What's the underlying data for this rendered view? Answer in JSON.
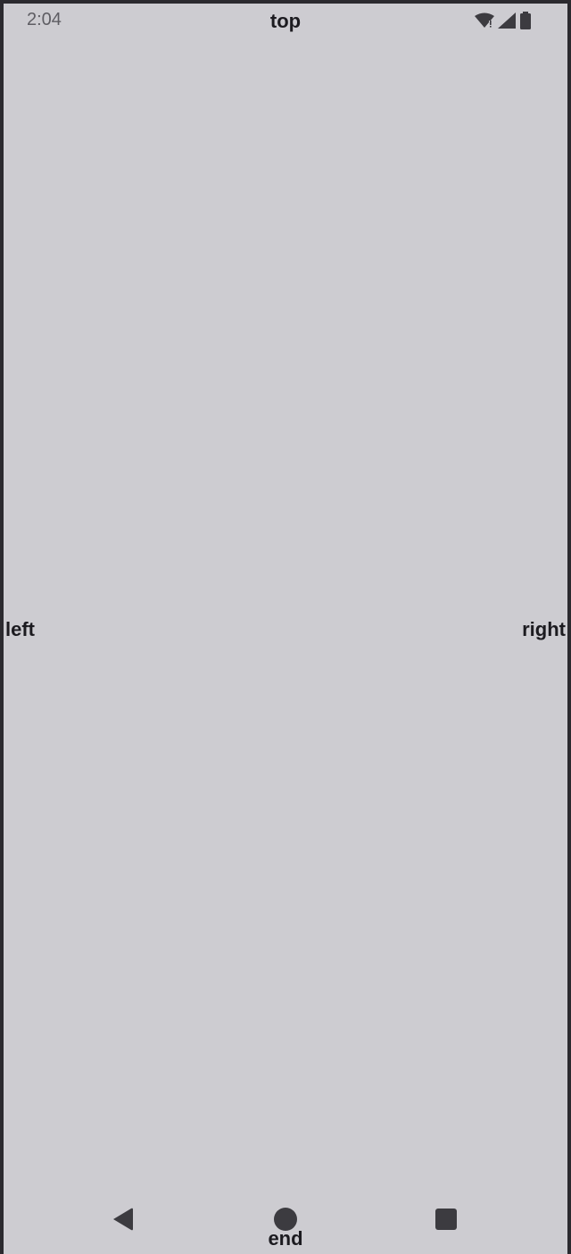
{
  "status_bar": {
    "time": "2:04",
    "icons": [
      "wifi-icon",
      "signal-icon",
      "battery-icon"
    ]
  },
  "labels": {
    "top": "top",
    "left": "left",
    "right": "right",
    "end": "end"
  },
  "nav_bar": {
    "buttons": [
      "back-icon",
      "home-icon",
      "recents-icon"
    ]
  },
  "colors": {
    "background": "#cdccd1",
    "frame": "#2b2a2f",
    "text": "#1c1b20",
    "icon": "#3c3b40"
  }
}
